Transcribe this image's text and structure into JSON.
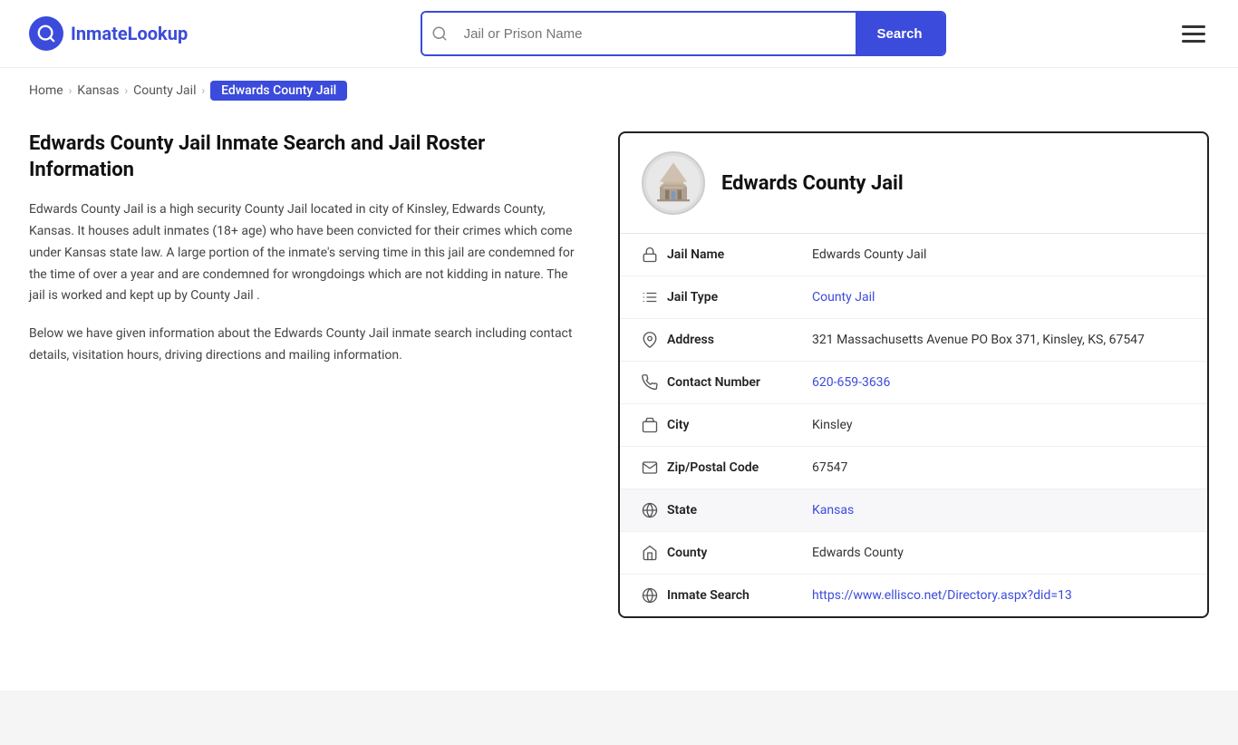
{
  "header": {
    "logo_text_part1": "Inmate",
    "logo_text_part2": "Lookup",
    "logo_icon": "🔍",
    "search_placeholder": "Jail or Prison Name",
    "search_btn_label": "Search"
  },
  "breadcrumb": {
    "home": "Home",
    "state": "Kansas",
    "type": "County Jail",
    "current": "Edwards County Jail"
  },
  "left": {
    "title": "Edwards County Jail Inmate Search and Jail Roster Information",
    "desc1": "Edwards County Jail is a high security County Jail located in city of Kinsley, Edwards County, Kansas. It houses adult inmates (18+ age) who have been convicted for their crimes which come under Kansas state law. A large portion of the inmate's serving time in this jail are condemned for the time of over a year and are condemned for wrongdoings which are not kidding in nature. The jail is worked and kept up by County Jail .",
    "desc2": "Below we have given information about the Edwards County Jail inmate search including contact details, visitation hours, driving directions and mailing information."
  },
  "card": {
    "title": "Edwards County Jail",
    "rows": [
      {
        "label": "Jail Name",
        "value": "Edwards County Jail",
        "link": null,
        "alt": false
      },
      {
        "label": "Jail Type",
        "value": "County Jail",
        "link": "#",
        "alt": false
      },
      {
        "label": "Address",
        "value": "321 Massachusetts Avenue PO Box 371, Kinsley, KS, 67547",
        "link": null,
        "alt": false
      },
      {
        "label": "Contact Number",
        "value": "620-659-3636",
        "link": "tel:620-659-3636",
        "alt": false
      },
      {
        "label": "City",
        "value": "Kinsley",
        "link": null,
        "alt": false
      },
      {
        "label": "Zip/Postal Code",
        "value": "67547",
        "link": null,
        "alt": false
      },
      {
        "label": "State",
        "value": "Kansas",
        "link": "#",
        "alt": true
      },
      {
        "label": "County",
        "value": "Edwards County",
        "link": null,
        "alt": false
      },
      {
        "label": "Inmate Search",
        "value": "https://www.ellisco.net/Directory.aspx?did=13",
        "link": "https://www.ellisco.net/Directory.aspx?did=13",
        "alt": false
      }
    ]
  }
}
